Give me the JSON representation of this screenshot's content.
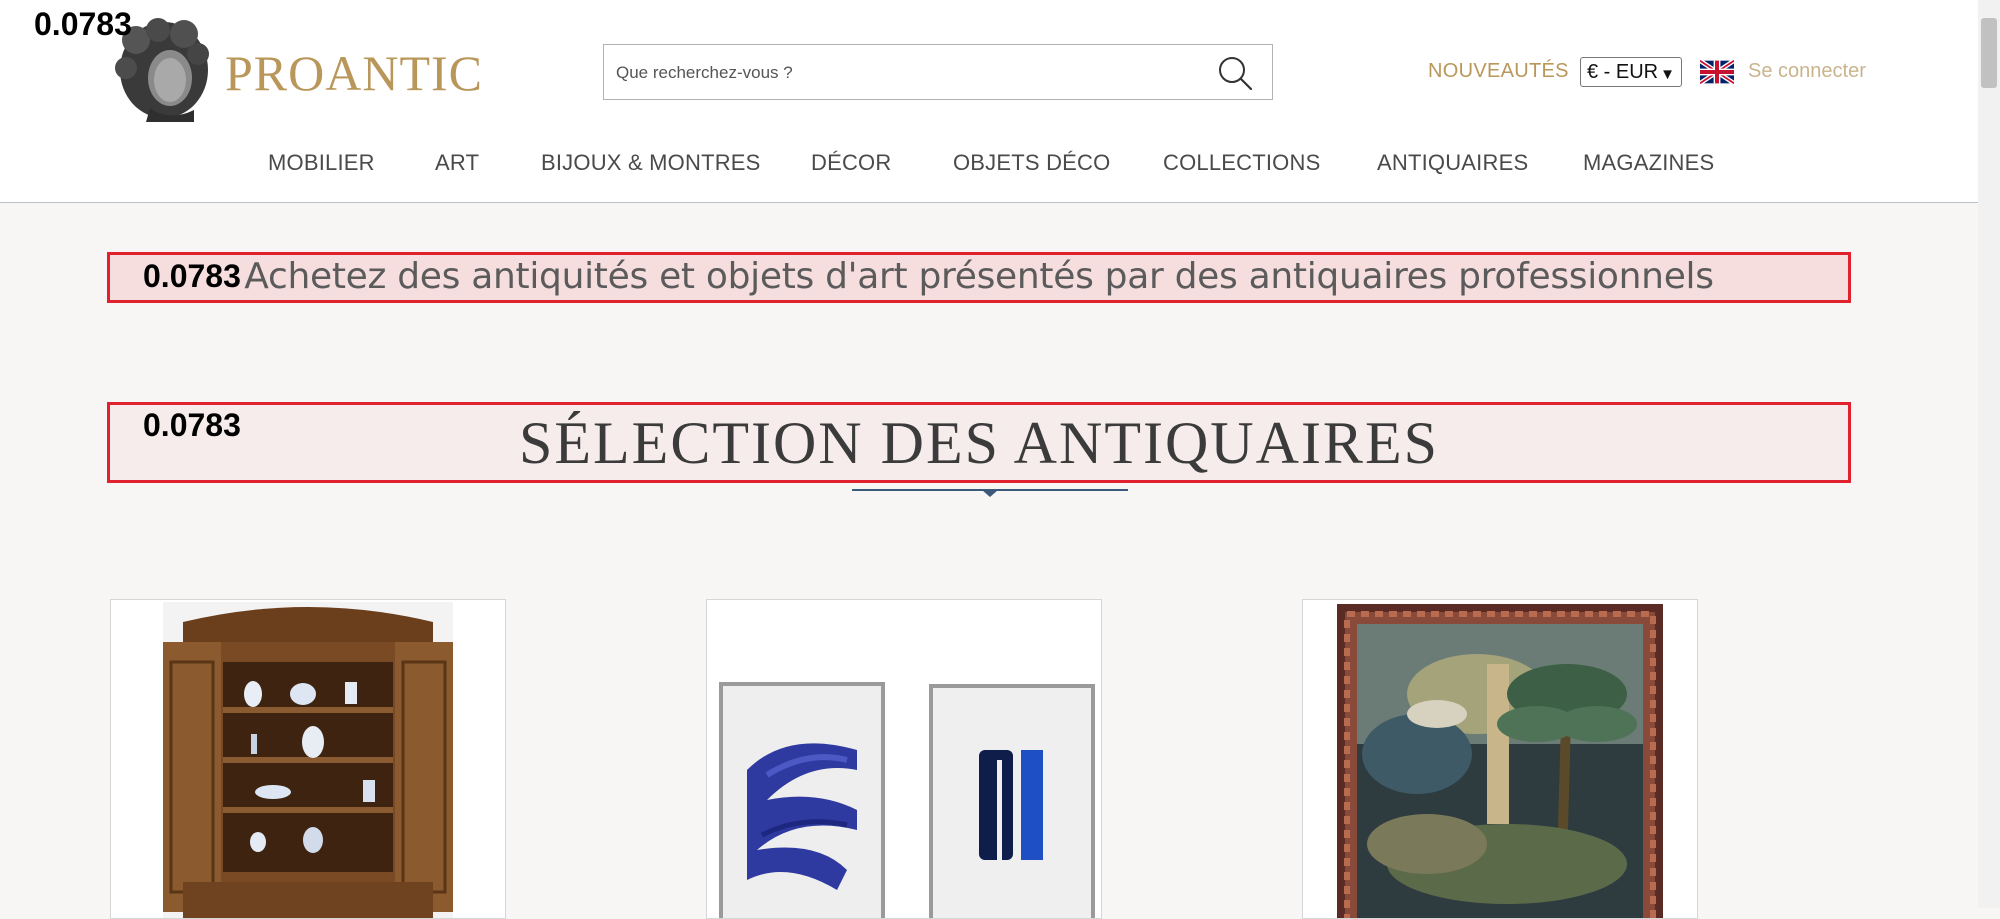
{
  "header": {
    "logo_text": "PROANTIC",
    "search_placeholder": "Que recherchez-vous ?",
    "nouveautes": "NOUVEAUTÉS",
    "currency": "€ - EUR",
    "language_flag": "uk-flag-icon",
    "connect": "Se connecter"
  },
  "nav": [
    {
      "label": "MOBILIER"
    },
    {
      "label": "ART"
    },
    {
      "label": "BIJOUX & MONTRES"
    },
    {
      "label": "DÉCOR"
    },
    {
      "label": "OBJETS DÉCO"
    },
    {
      "label": "COLLECTIONS"
    },
    {
      "label": "ANTIQUAIRES"
    },
    {
      "label": "MAGAZINES"
    }
  ],
  "badges": {
    "top": "0.0783",
    "tagline": "0.0783",
    "section": "0.0783"
  },
  "main": {
    "tagline": "Achetez des antiquités et objets d'art présentés par des antiquaires professionnels",
    "section_title": "SÉLECTION DES ANTIQUAIRES"
  },
  "products": [
    {
      "name": "carved-wood-cabinet-image"
    },
    {
      "name": "blue-abstract-prints-image"
    },
    {
      "name": "tapestry-image"
    }
  ],
  "colors": {
    "brand_gold": "#b9975b",
    "highlight_border": "#e0212e"
  }
}
